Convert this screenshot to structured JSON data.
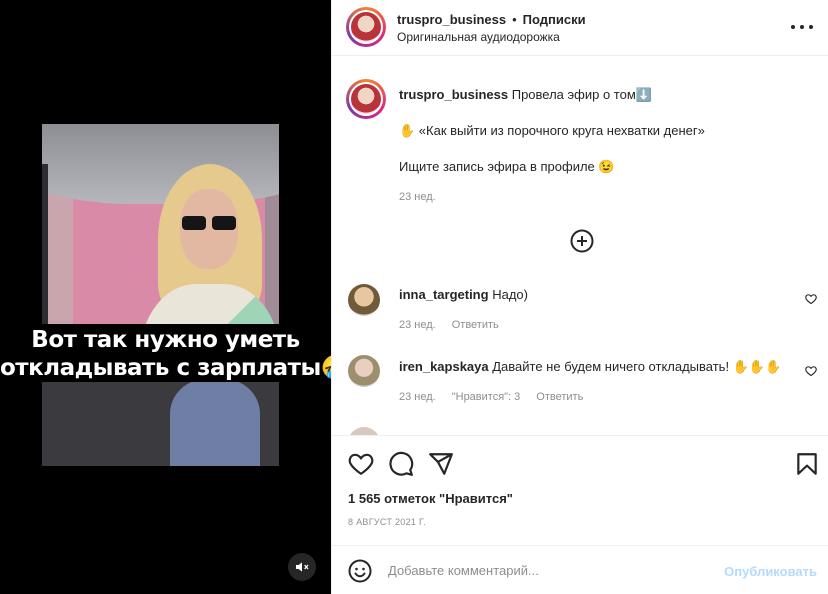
{
  "video": {
    "caption_line1": "Вот так нужно уметь",
    "caption_line2": "откладывать с зарплаты🤣",
    "mute_icon": "speaker-muted-icon"
  },
  "header": {
    "username": "truspro_business",
    "separator": "•",
    "follow_label": "Подписки",
    "audio_label": "Оригинальная аудиодорожка",
    "more_icon": "more-horizontal-icon"
  },
  "post_caption": {
    "username": "truspro_business",
    "text_line1": "Провела эфир о том⬇️",
    "text_line2": "✋ «Как выйти из порочного круга нехватки денег»",
    "text_line3": "Ищите запись эфира в профиле 😉",
    "time": "23 нед."
  },
  "load_more_icon": "plus-circle-icon",
  "comments": [
    {
      "username": "inna_targeting",
      "text": "Надо)",
      "time": "23 нед.",
      "reply_label": "Ответить",
      "likes_label": ""
    },
    {
      "username": "iren_kapskaya",
      "text": "Давайте не будем ничего откладывать! ✋✋✋",
      "time": "23 нед.",
      "likes_label": "\"Нравится\": 3",
      "reply_label": "Ответить"
    }
  ],
  "actions": {
    "likes_text": "1 565 отметок \"Нравится\"",
    "date": "8 АВГУСТ 2021 Г."
  },
  "add_comment": {
    "placeholder": "Добавьте комментарий...",
    "post_label": "Опубликовать"
  },
  "colors": {
    "text": "#262626",
    "muted": "#8e8e8e",
    "post_button_disabled": "#b3dbff",
    "border": "#efefef"
  }
}
